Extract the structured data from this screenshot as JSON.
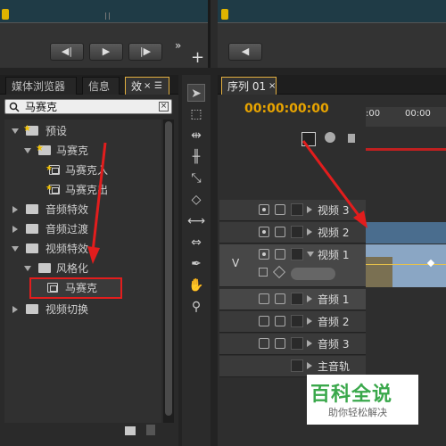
{
  "panel_tabs": {
    "media_browser": "媒体浏览器",
    "info": "信息",
    "effects_tab": "效"
  },
  "search": {
    "value": "马赛克"
  },
  "tree": {
    "presets": "预设",
    "mosaic_folder": "马赛克",
    "mosaic_in": "马赛克入",
    "mosaic_out": "马赛克出",
    "audio_effects": "音频特效",
    "audio_transitions": "音频过渡",
    "video_effects": "视频特效",
    "stylize": "风格化",
    "mosaic_effect": "马赛克",
    "video_transitions": "视频切换"
  },
  "sequence": {
    "tab": "序列 01",
    "timecode": "00:00:00:00",
    "ruler": [
      ":00",
      "00:00"
    ],
    "v_label": "V"
  },
  "tracks": {
    "video3": "视频 3",
    "video2": "视频 2",
    "video1": "视频 1",
    "audio1": "音频 1",
    "audio2": "音频 2",
    "audio3": "音频 3",
    "master": "主音轨"
  },
  "watermark": {
    "title": "百科全说",
    "subtitle": "助你轻松解决"
  },
  "colors": {
    "timecode": "#e8a400",
    "arrow": "#e21d1d",
    "highlight_border": "#e21d1d",
    "clip_blue": "#4a6d8e",
    "watermark_green": "#3aa84b"
  }
}
